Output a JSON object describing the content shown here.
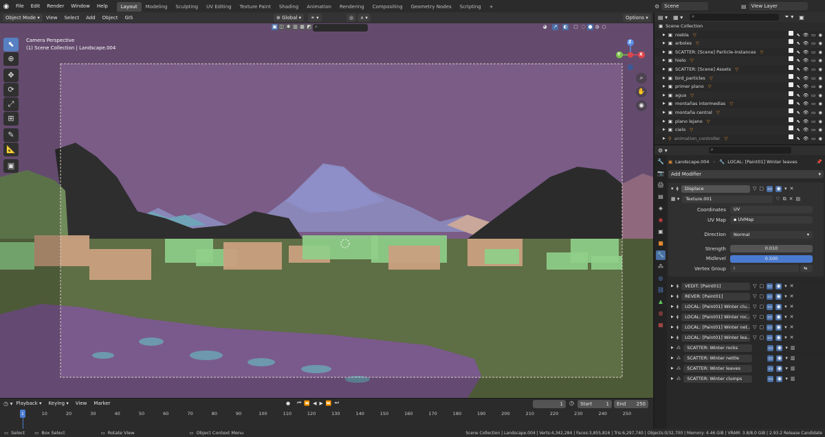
{
  "top_menu": [
    "File",
    "Edit",
    "Render",
    "Window",
    "Help"
  ],
  "workspaces": [
    "Layout",
    "Modeling",
    "Sculpting",
    "UV Editing",
    "Texture Paint",
    "Shading",
    "Animation",
    "Rendering",
    "Compositing",
    "Geometry Nodes",
    "Scripting"
  ],
  "active_workspace": "Layout",
  "scene_name": "Scene",
  "view_layer": "View Layer",
  "header": {
    "mode": "Object Mode",
    "menus": [
      "View",
      "Select",
      "Add",
      "Object",
      "GIS"
    ],
    "transform_orientation": "Global",
    "options_label": "Options"
  },
  "viewport": {
    "line1": "Camera Perspective",
    "line2": "(1) Scene Collection | Landscape.004",
    "gizmo_axes": [
      "Z",
      "Y",
      "X"
    ]
  },
  "outliner": {
    "root": "Scene Collection",
    "items": [
      "niebla",
      "arboles",
      "SCATTER: [Scene] Particle-Instances",
      "hielo",
      "SCATTER: [Scene] Assets",
      "bird_particles",
      "primer plano",
      "agua",
      "montañas intermedias",
      "montaña central",
      "plano lejano",
      "cielo",
      "animation_controller"
    ]
  },
  "properties": {
    "breadcrumb_object": "Landscape.004",
    "breadcrumb_modifier": "LOCAL: [Paint01] Winter leaves",
    "add_modifier": "Add Modifier",
    "displace": {
      "name": "Displace",
      "texture": "Texture.001",
      "coordinates_label": "Coordinates",
      "coordinates_value": "UV",
      "uvmap_label": "UV Map",
      "uvmap_value": "UVMap",
      "direction_label": "Direction",
      "direction_value": "Normal",
      "strength_label": "Strength",
      "strength_value": "0.010",
      "midlevel_label": "Midlevel",
      "midlevel_value": "0.500",
      "vertex_group_label": "Vertex Group"
    },
    "modifiers": [
      "VEDIT: [Paint01]",
      "REVER: [Paint01]",
      "LOCAL: [Paint01] Winter clu...",
      "LOCAL: [Paint01] Winter roc...",
      "LOCAL: [Paint01] Winter net...",
      "LOCAL: [Paint01] Winter lea...",
      "SCATTER: Winter rocks",
      "SCATTER: Winter nettle",
      "SCATTER: Winter leaves",
      "SCATTER: Winter clumps"
    ]
  },
  "timeline": {
    "menus": [
      "Playback",
      "Keying",
      "View",
      "Marker"
    ],
    "current_frame": "1",
    "start_label": "Start",
    "start_value": "1",
    "end_label": "End",
    "end_value": "250",
    "ticks": [
      "1",
      "10",
      "20",
      "30",
      "40",
      "50",
      "60",
      "70",
      "80",
      "90",
      "100",
      "110",
      "120",
      "130",
      "140",
      "150",
      "160",
      "170",
      "180",
      "190",
      "200",
      "210",
      "220",
      "230",
      "240",
      "250"
    ]
  },
  "statusbar": {
    "select": "Select",
    "box_select": "Box Select",
    "rotate_view": "Rotate View",
    "context_menu": "Object Context Menu",
    "stats": "Scene Collection | Landscape.004 | Verts:4,342,284 | Faces:3,855,816 | Tris:6,297,740 | Objects:0/32,700 | Memory: 4.46 GiB | VRAM: 3.8/8.0 GiB | 2.93.2 Release Candidate"
  },
  "colors": {
    "accent": "#5680c2",
    "sky": "#7a5c87",
    "ground": "#5e6e45",
    "selected_red": "#e0454b"
  }
}
